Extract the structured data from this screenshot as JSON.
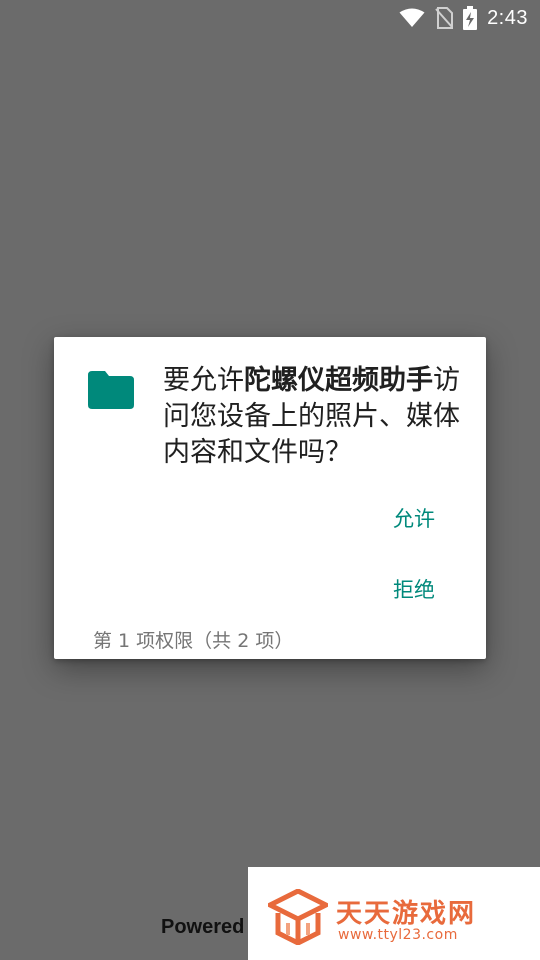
{
  "status_bar": {
    "time": "2:43",
    "icons": [
      "wifi-icon",
      "no-sim-icon",
      "battery-charging-icon"
    ]
  },
  "dialog": {
    "icon": "folder-icon",
    "accent_color": "#00897b",
    "message_prefix": "要允许",
    "app_name": "陀螺仪超频助手",
    "message_suffix": "访问您设备上的照片、媒体内容和文件吗？",
    "allow_label": "允许",
    "deny_label": "拒绝",
    "counter": "第 1 项权限（共 2 项）"
  },
  "footer": {
    "powered_text": "Powered"
  },
  "watermark": {
    "title": "天天游戏网",
    "url": "www.ttyl23.com",
    "color": "#e86a3c"
  }
}
